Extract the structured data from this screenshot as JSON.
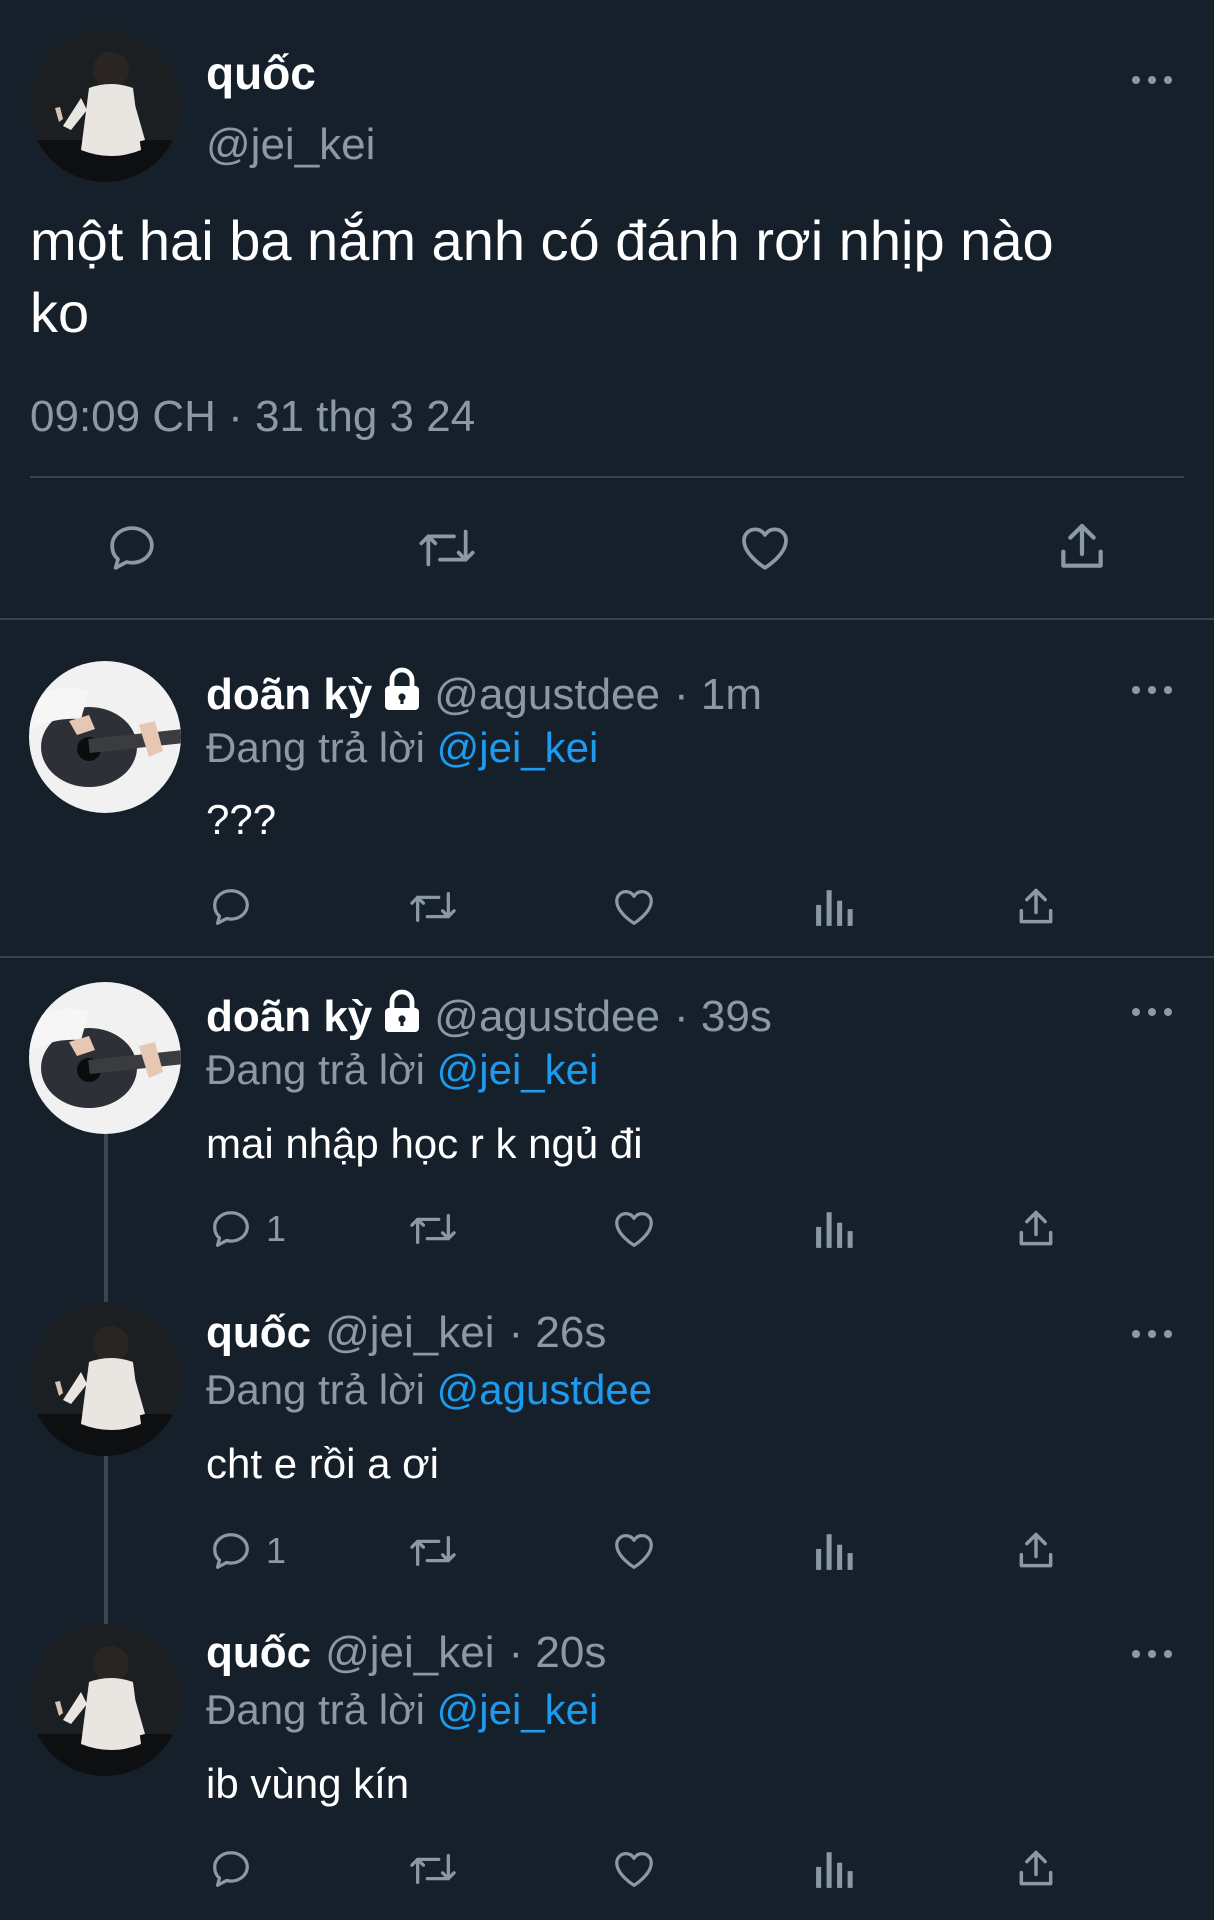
{
  "main_tweet": {
    "display_name": "quốc",
    "handle": "@jei_kei",
    "text_line1": "một hai ba nắm anh có đánh rơi nhịp nào",
    "text_line2": "ko",
    "timestamp": "09:09 CH · 31 thg 3 24"
  },
  "replies": [
    {
      "display_name": "doãn kỳ",
      "locked": true,
      "handle": "@agustdee",
      "time": "· 1m",
      "replying_prefix": "Đang trả lời",
      "replying_to": "@jei_kei",
      "text": "???",
      "reply_count": ""
    },
    {
      "display_name": "doãn kỳ",
      "locked": true,
      "handle": "@agustdee",
      "time": "· 39s",
      "replying_prefix": "Đang trả lời",
      "replying_to": "@jei_kei",
      "text": "mai nhập học r k ngủ đi",
      "reply_count": "1"
    },
    {
      "display_name": "quốc",
      "locked": false,
      "handle": "@jei_kei",
      "time": "· 26s",
      "replying_prefix": "Đang trả lời",
      "replying_to": "@agustdee",
      "text": "cht e rồi a ơi",
      "reply_count": "1"
    },
    {
      "display_name": "quốc",
      "locked": false,
      "handle": "@jei_kei",
      "time": "· 20s",
      "replying_prefix": "Đang trả lời",
      "replying_to": "@jei_kei",
      "text": "ib vùng kín",
      "reply_count": ""
    }
  ],
  "icons": {
    "reply": "speech-bubble",
    "retweet": "retweet-arrows",
    "like": "heart",
    "views": "bar-chart",
    "share": "upload-arrow",
    "more": "three-dots"
  },
  "colors": {
    "background": "#15202b",
    "text": "#ffffff",
    "muted": "#8b98a5",
    "link": "#1d9bf0",
    "divider": "#38444d"
  }
}
